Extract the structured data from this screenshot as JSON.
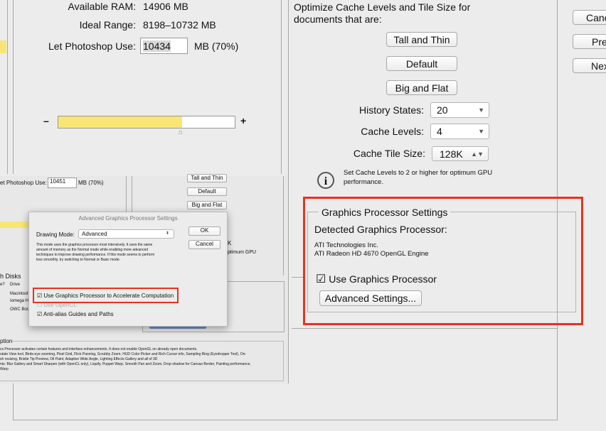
{
  "memory": {
    "available_label": "Available RAM:",
    "available_value": "14906 MB",
    "ideal_label": "Ideal Range:",
    "ideal_value": "8198–10732 MB",
    "use_label": "Let Photoshop Use:",
    "use_value": "10434",
    "use_unit": "MB (70%)",
    "slider_percent": 70,
    "minus": "–",
    "plus": "+"
  },
  "history": {
    "optimize_line1": "Optimize Cache Levels and Tile Size for",
    "optimize_line2": "documents that are:",
    "tall_thin": "Tall and Thin",
    "default": "Default",
    "big_flat": "Big and Flat",
    "history_label": "History States:",
    "history_value": "20",
    "levels_label": "Cache Levels:",
    "levels_value": "4",
    "tile_label": "Cache Tile Size:",
    "tile_value": "128K",
    "info_text_1": "Set Cache Levels to 2 or higher for optimum GPU",
    "info_text_2": "performance."
  },
  "side_buttons": {
    "cancel": "Canc",
    "prev": "Pre",
    "next": "Nex"
  },
  "gpu": {
    "title": "Graphics Processor Settings",
    "detected_label": "Detected Graphics Processor:",
    "vendor": "ATI Technologies Inc.",
    "model": "ATI Radeon HD 4670 OpenGL Engine",
    "use_gpu": "Use Graphics Processor",
    "use_gpu_checked": true,
    "advanced": "Advanced Settings..."
  },
  "inset": {
    "use_label": "et Photoshop Use:",
    "use_value": "10451",
    "use_unit": "MB (70%)",
    "tall_thin": "Tall and Thin",
    "default": "Default",
    "big_flat": "Big and Flat",
    "k": "K",
    "gpu_text": "ptimum GPU",
    "disks_title": "h Disks",
    "col1": "e?",
    "col2": "Drive",
    "disk1": "Macintosh",
    "disk2": "Iomega HI",
    "disk3": "OWC Boot",
    "desc_title": "ption",
    "desc_lines": [
      "cs Processor activates certain features and interface enhancements. It does not enable OpenGL on already open documents.",
      "otate View tool, Birds-eye zooming, Pixel Grid, Flick Panning, Scrubby Zoom, HUD Color Picker and Rich Cursor info, Sampling Ring (Eyedropper Tool), On-",
      "sh resizing, Bristle Tip Preview, Oil Paint, Adaptive Wide Angle, Lighting Effects Gallery and all of 3D",
      "nts: Blur Gallery and Smart Sharpen (with OpenCL only), Liquify, Puppet Warp, Smooth Pan and Zoom, Drop shadow for Canvas Border, Painting performance,",
      "Warp"
    ]
  },
  "dialog": {
    "title": "Advanced Graphics Processor Settings",
    "mode_label": "Drawing Mode:",
    "mode_value": "Advanced",
    "ok": "OK",
    "cancel": "Cancel",
    "desc_lines": [
      "This mode uses the graphics processor most intensively.  It uses the same",
      "amount of memory as the Normal mode while enabling more advanced",
      "techniques to improve drawing performance.  If this mode seems to perform",
      "less smoothly, try switching to Normal or Basic mode."
    ],
    "accel": "Use Graphics Processor to Accelerate Computation",
    "accel_checked": true,
    "opencl": "Use OpenCL",
    "opencl_checked": false,
    "antialias": "Anti-alias Guides and Paths",
    "antialias_checked": true
  },
  "colors": {
    "highlight": "#e8321e",
    "slider_fill": "#f9e574"
  }
}
